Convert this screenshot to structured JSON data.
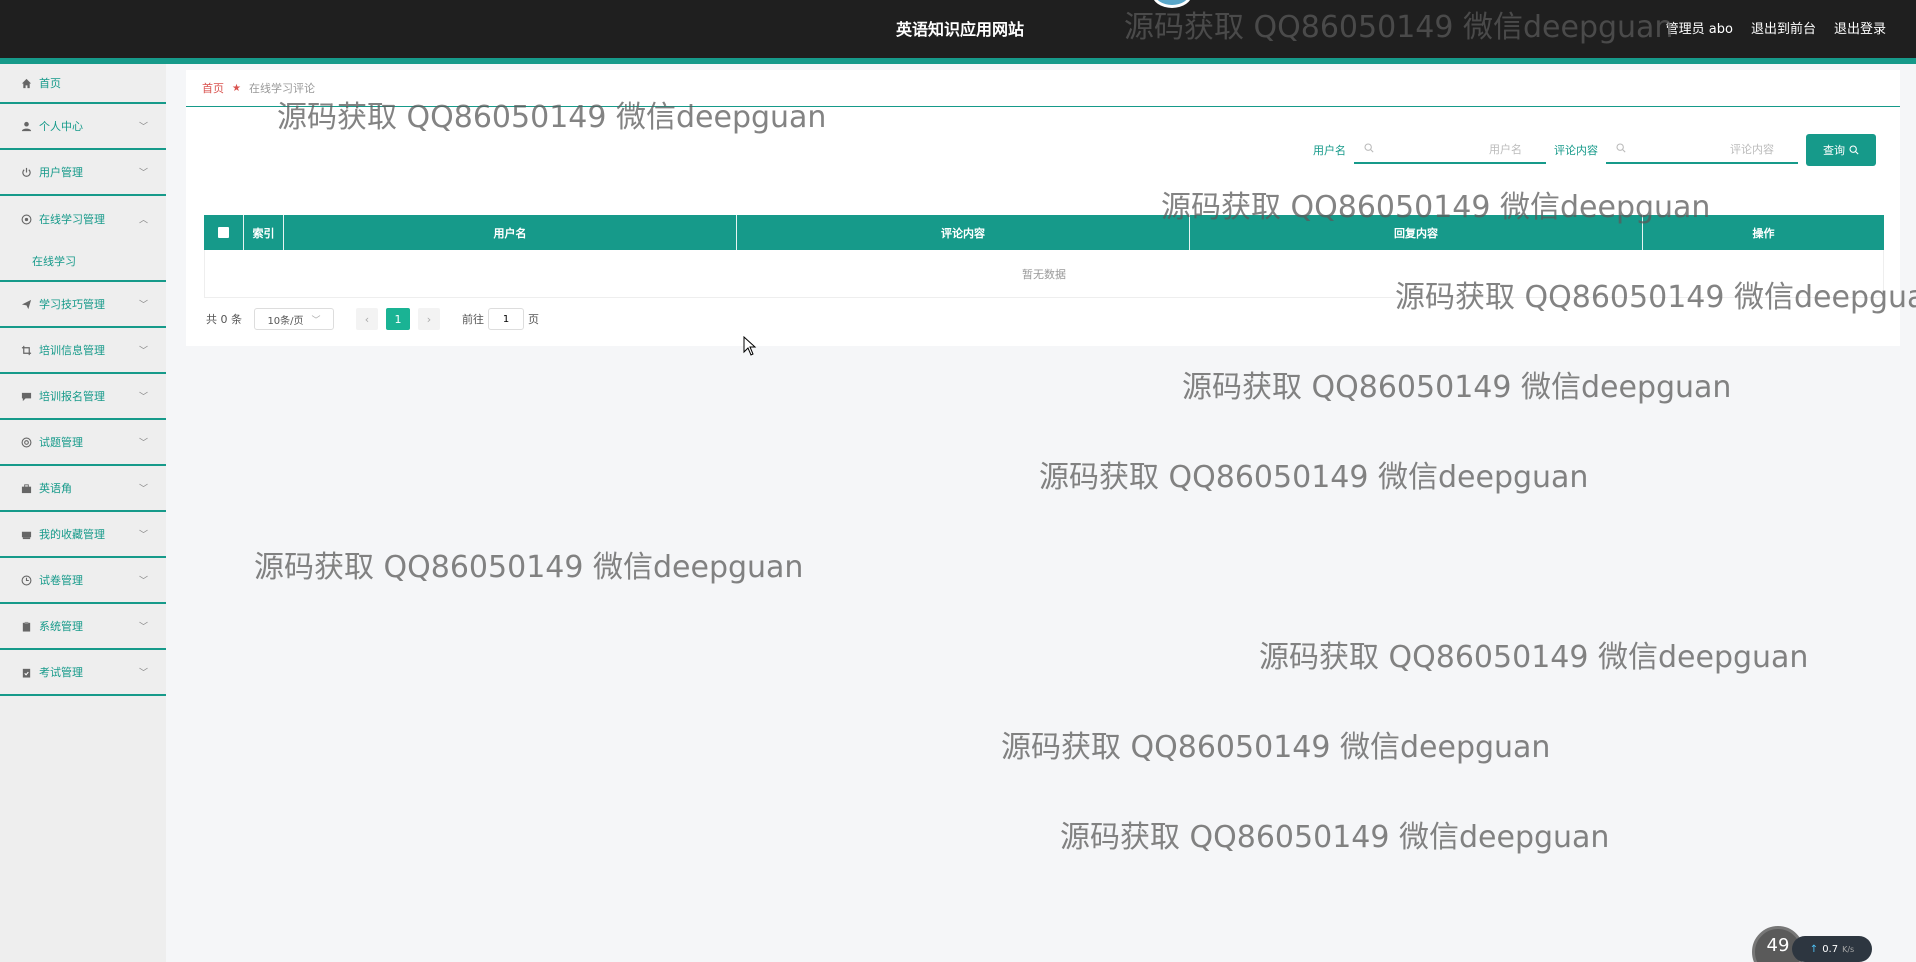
{
  "header": {
    "site_title": "英语知识应用网站",
    "user_label": "管理员 abo",
    "to_front": "退出到前台",
    "logout": "退出登录"
  },
  "sidebar": {
    "items": [
      {
        "label": "首页",
        "icon": "home-icon"
      },
      {
        "label": "个人中心",
        "icon": "user-icon"
      },
      {
        "label": "用户管理",
        "icon": "power-icon"
      },
      {
        "label": "在线学习管理",
        "icon": "globe-icon",
        "expanded": true
      },
      {
        "label": "学习技巧管理",
        "icon": "send-icon"
      },
      {
        "label": "培训信息管理",
        "icon": "crop-icon"
      },
      {
        "label": "培训报名管理",
        "icon": "comment-icon"
      },
      {
        "label": "试题管理",
        "icon": "at-icon"
      },
      {
        "label": "英语角",
        "icon": "briefcase-icon"
      },
      {
        "label": "我的收藏管理",
        "icon": "tray-icon"
      },
      {
        "label": "试卷管理",
        "icon": "clock-icon"
      },
      {
        "label": "系统管理",
        "icon": "clipboard-icon"
      },
      {
        "label": "考试管理",
        "icon": "clipboard-check-icon"
      }
    ],
    "submenu": {
      "label": "在线学习"
    }
  },
  "breadcrumb": {
    "home": "首页",
    "current": "在线学习评论"
  },
  "search": {
    "username_label": "用户名",
    "username_placeholder": "用户名",
    "comment_label": "评论内容",
    "comment_placeholder": "评论内容",
    "query_label": "查询"
  },
  "table": {
    "columns": [
      "索引",
      "用户名",
      "评论内容",
      "回复内容",
      "操作"
    ],
    "empty_text": "暂无数据"
  },
  "pagination": {
    "total": "共 0 条",
    "page_size": "10条/页",
    "current_page": "1",
    "goto_label": "前往",
    "goto_value": "1",
    "page_suffix": "页"
  },
  "watermark": "源码获取 QQ86050149 微信deepguan",
  "net_widget": {
    "percent": "49",
    "speed": "0.7",
    "unit": "K/s"
  },
  "colors": {
    "accent": "#169a8a",
    "topbar": "#1f1f1f",
    "sidebar_bg": "#eeeeee",
    "page_bg": "#f5f6f8",
    "breadcrumb_home": "#d9534f",
    "active_page": "#1ab394"
  }
}
